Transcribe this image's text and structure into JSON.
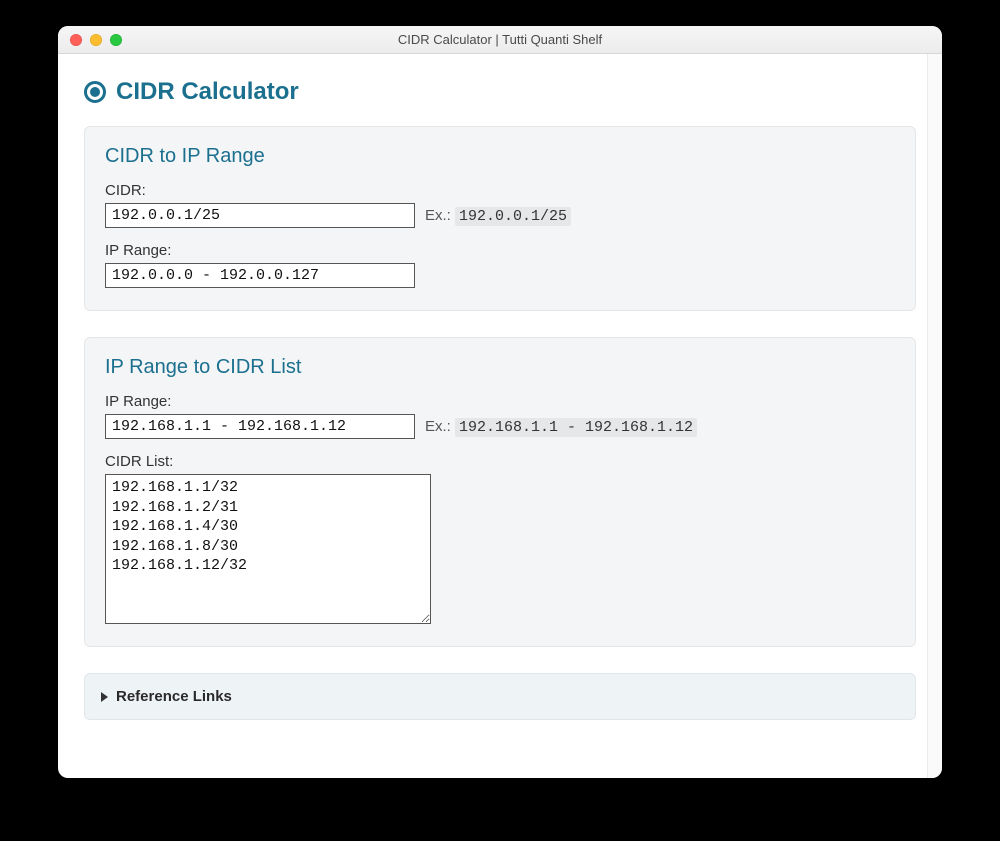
{
  "window": {
    "title": "CIDR Calculator | Tutti Quanti Shelf"
  },
  "header": {
    "page_title": "CIDR Calculator"
  },
  "section1": {
    "title": "CIDR to IP Range",
    "cidr_label": "CIDR:",
    "cidr_value": "192.0.0.1/25",
    "cidr_hint_prefix": "Ex.: ",
    "cidr_hint_code": "192.0.0.1/25",
    "range_label": "IP Range:",
    "range_value": "192.0.0.0 - 192.0.0.127"
  },
  "section2": {
    "title": "IP Range to CIDR List",
    "range_label": "IP Range:",
    "range_value": "192.168.1.1 - 192.168.1.12",
    "range_hint_prefix": "Ex.: ",
    "range_hint_code": "192.168.1.1 - 192.168.1.12",
    "list_label": "CIDR List:",
    "list_value": "192.168.1.1/32\n192.168.1.2/31\n192.168.1.4/30\n192.168.1.8/30\n192.168.1.12/32"
  },
  "accordion": {
    "label": "Reference Links"
  }
}
